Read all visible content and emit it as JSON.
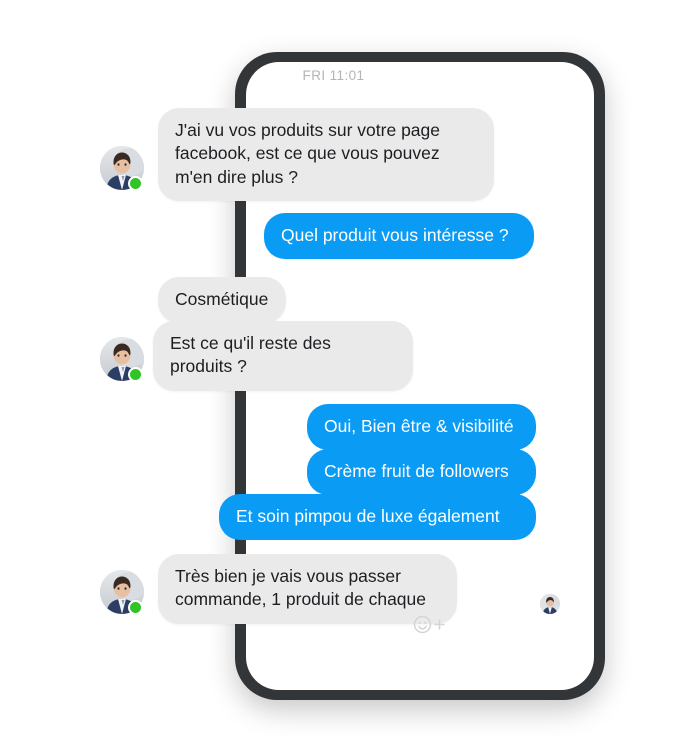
{
  "device": {
    "frame_color": "#333638",
    "screen_background": "#ffffff"
  },
  "theme": {
    "outgoing_bubble_color": "#0a9bf5",
    "incoming_bubble_color": "#eaeaea",
    "outgoing_text_color": "#ffffff",
    "incoming_text_color": "#1c1e21",
    "presence_online_color": "#31c425",
    "timestamp_color": "#b3b5b8"
  },
  "conversation": {
    "timestamp": "FRI 11:01",
    "messages": [
      {
        "id": "m0",
        "sender": "them",
        "text": "J'ai vu vos produits sur votre page facebook, est ce que vous pouvez m'en dire plus ?"
      },
      {
        "id": "m1",
        "sender": "me",
        "text": "Quel produit vous intéresse ?"
      },
      {
        "id": "m2",
        "sender": "them",
        "text": "Cosmétique"
      },
      {
        "id": "m3",
        "sender": "them",
        "text": "Est ce qu'il reste des produits ?"
      },
      {
        "id": "m4",
        "sender": "me",
        "text": "Oui, Bien être & visibilité"
      },
      {
        "id": "m5",
        "sender": "me",
        "text": "Crème fruit de followers"
      },
      {
        "id": "m6",
        "sender": "me",
        "text": "Et soin pimpou de luxe également"
      },
      {
        "id": "m7",
        "sender": "them",
        "text": "Très bien je vais vous passer commande, 1 produit de chaque"
      }
    ],
    "avatars": [
      {
        "id": "a0",
        "name": "contact-avatar",
        "presence": "online"
      },
      {
        "id": "a1",
        "name": "contact-avatar",
        "presence": "online"
      },
      {
        "id": "a2",
        "name": "contact-avatar",
        "presence": "online"
      }
    ],
    "seen_by_avatar": {
      "name": "seen-by-avatar"
    },
    "add_reaction": {
      "icon": "smiley-plus-icon",
      "label": "+"
    }
  }
}
